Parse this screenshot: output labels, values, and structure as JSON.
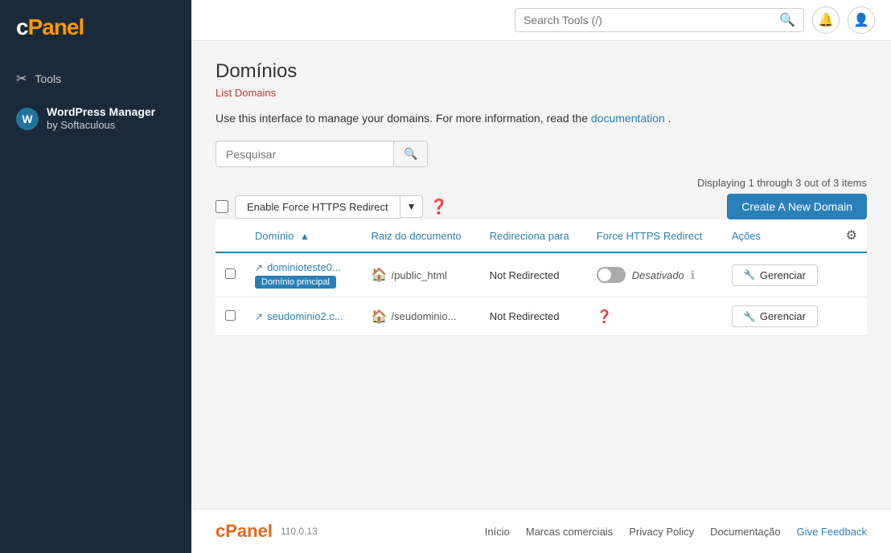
{
  "sidebar": {
    "logo": "cPanel",
    "nav_items": [
      {
        "id": "tools",
        "label": "Tools",
        "icon": "✂"
      }
    ],
    "wordpress": {
      "label": "WordPress Manager",
      "sublabel": "by Softaculous"
    }
  },
  "header": {
    "search_placeholder": "Search Tools (/)",
    "search_value": ""
  },
  "page": {
    "title": "Domínios",
    "breadcrumb": "List Domains",
    "description_before": "Use this interface to manage your domains. For more information, read the",
    "description_link": "documentation",
    "description_after": "."
  },
  "search": {
    "placeholder": "Pesquisar",
    "value": ""
  },
  "table": {
    "displaying": "Displaying 1 through 3 out of 3 items",
    "bulk_action_label": "Enable Force HTTPS Redirect",
    "create_button": "Create A New Domain",
    "columns": {
      "domain": "Domínio",
      "document_root": "Raiz do documento",
      "redirects_to": "Redireciona para",
      "force_https": "Force HTTPS Redirect",
      "actions": "Ações"
    },
    "rows": [
      {
        "id": 1,
        "domain": "dominioteste0...",
        "badge": "Domínio principal",
        "doc_root": "/public_html",
        "redirects_to": "Not Redirected",
        "force_https": "off",
        "force_https_label": "Desativado",
        "manage_label": "Gerenciar"
      },
      {
        "id": 2,
        "domain": "seudominio2.c...",
        "badge": null,
        "doc_root": "/seudominio...",
        "redirects_to": "Not Redirected",
        "force_https": null,
        "force_https_label": null,
        "manage_label": "Gerenciar"
      }
    ]
  },
  "footer": {
    "logo": "cPanel",
    "version": "110.0.13",
    "links": [
      {
        "label": "Início"
      },
      {
        "label": "Marcas comerciais"
      },
      {
        "label": "Privacy Policy"
      },
      {
        "label": "Documentação"
      },
      {
        "label": "Give Feedback"
      }
    ]
  }
}
